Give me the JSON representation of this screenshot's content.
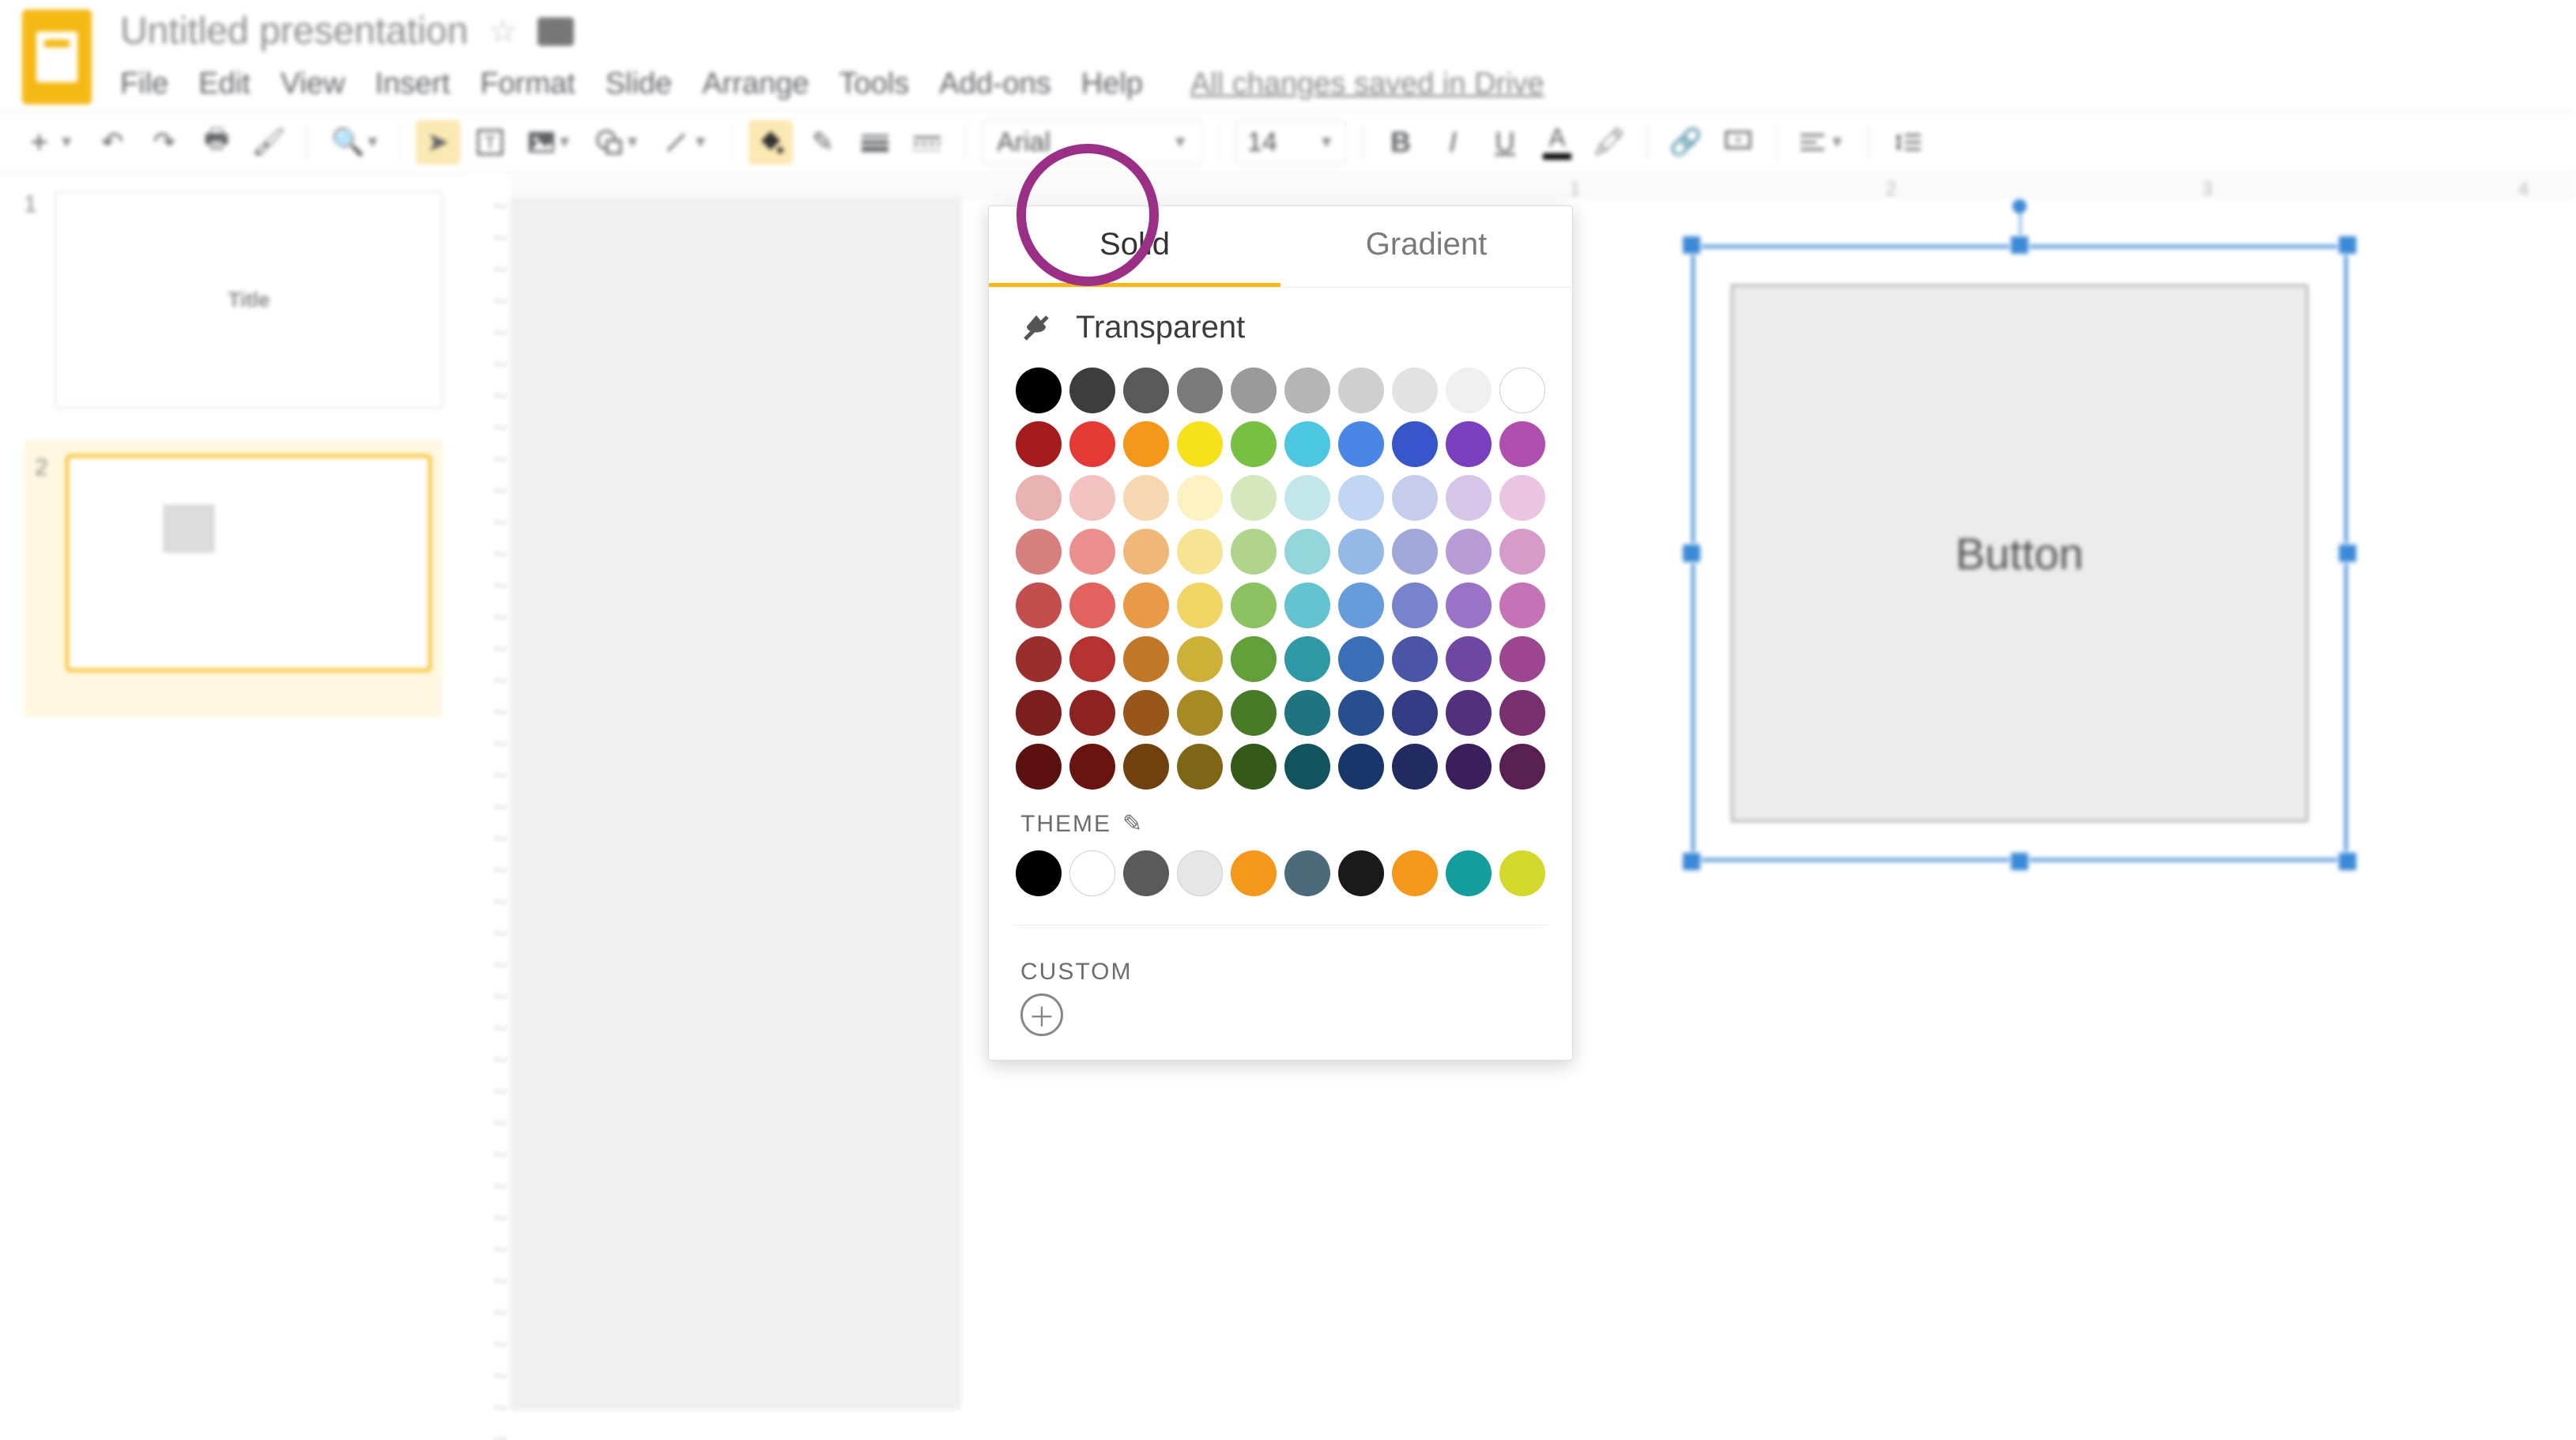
{
  "header": {
    "doc_title": "Untitled presentation",
    "menus": [
      "File",
      "Edit",
      "View",
      "Insert",
      "Format",
      "Slide",
      "Arrange",
      "Tools",
      "Add-ons",
      "Help"
    ],
    "save_status": "All changes saved in Drive"
  },
  "toolbar": {
    "font": "Arial",
    "font_size": "14"
  },
  "sidebar": {
    "slides": [
      {
        "num": "1",
        "label": "Title"
      },
      {
        "num": "2",
        "label": ""
      }
    ]
  },
  "ruler": {
    "marks": [
      "1",
      "2",
      "3",
      "4"
    ]
  },
  "shape": {
    "text": "Button"
  },
  "popup": {
    "tabs": {
      "solid": "Solid",
      "gradient": "Gradient"
    },
    "transparent": "Transparent",
    "theme_label": "THEME",
    "custom_label": "CUSTOM",
    "palette_rows": [
      [
        "#000000",
        "#3d3d3d",
        "#595959",
        "#7a7a7a",
        "#9a9a9a",
        "#b5b5b5",
        "#cfcfcf",
        "#e2e2e2",
        "#efefef",
        "#ffffff"
      ],
      [
        "#a61c1c",
        "#e53935",
        "#f4971a",
        "#f7e11b",
        "#77c042",
        "#4dc6e0",
        "#4a86e8",
        "#3555c9",
        "#7a3fbf",
        "#b14fb1"
      ],
      [
        "#e7b2b0",
        "#f2c1c0",
        "#f6d7b0",
        "#fbf1c1",
        "#d4e7bd",
        "#c3e6ea",
        "#c1d6f2",
        "#c6cceb",
        "#d6c5e8",
        "#e9c5e1"
      ],
      [
        "#d77f7d",
        "#ea8f8d",
        "#efb878",
        "#f6e493",
        "#b0d48c",
        "#94d5dc",
        "#94b9e6",
        "#9fa8d9",
        "#b89bd6",
        "#d79bcb"
      ],
      [
        "#c24f4d",
        "#e2625f",
        "#e89a46",
        "#f0d564",
        "#8cc260",
        "#63c3cf",
        "#669cdc",
        "#7783cb",
        "#9a72c6",
        "#c572b6"
      ],
      [
        "#9a2e2c",
        "#b4322f",
        "#c27627",
        "#cdb037",
        "#619f38",
        "#2f98a6",
        "#3a6fb8",
        "#4a55a8",
        "#6f46a1",
        "#9c4690"
      ],
      [
        "#7a1f1d",
        "#8e2220",
        "#98571a",
        "#a88a24",
        "#497a27",
        "#1f7480",
        "#274e8e",
        "#333c82",
        "#52307c",
        "#78306e"
      ],
      [
        "#5b120f",
        "#6a1412",
        "#70400f",
        "#7f6617",
        "#335a19",
        "#12535d",
        "#183669",
        "#222a62",
        "#3b1f5c",
        "#591f51"
      ]
    ],
    "theme_colors": [
      "#000000",
      "#ffffff",
      "#595959",
      "#e6e6e6",
      "#f4971a",
      "#4b6b7c",
      "#1a1a1a",
      "#f4971a",
      "#139e9e",
      "#d3d82a"
    ]
  }
}
